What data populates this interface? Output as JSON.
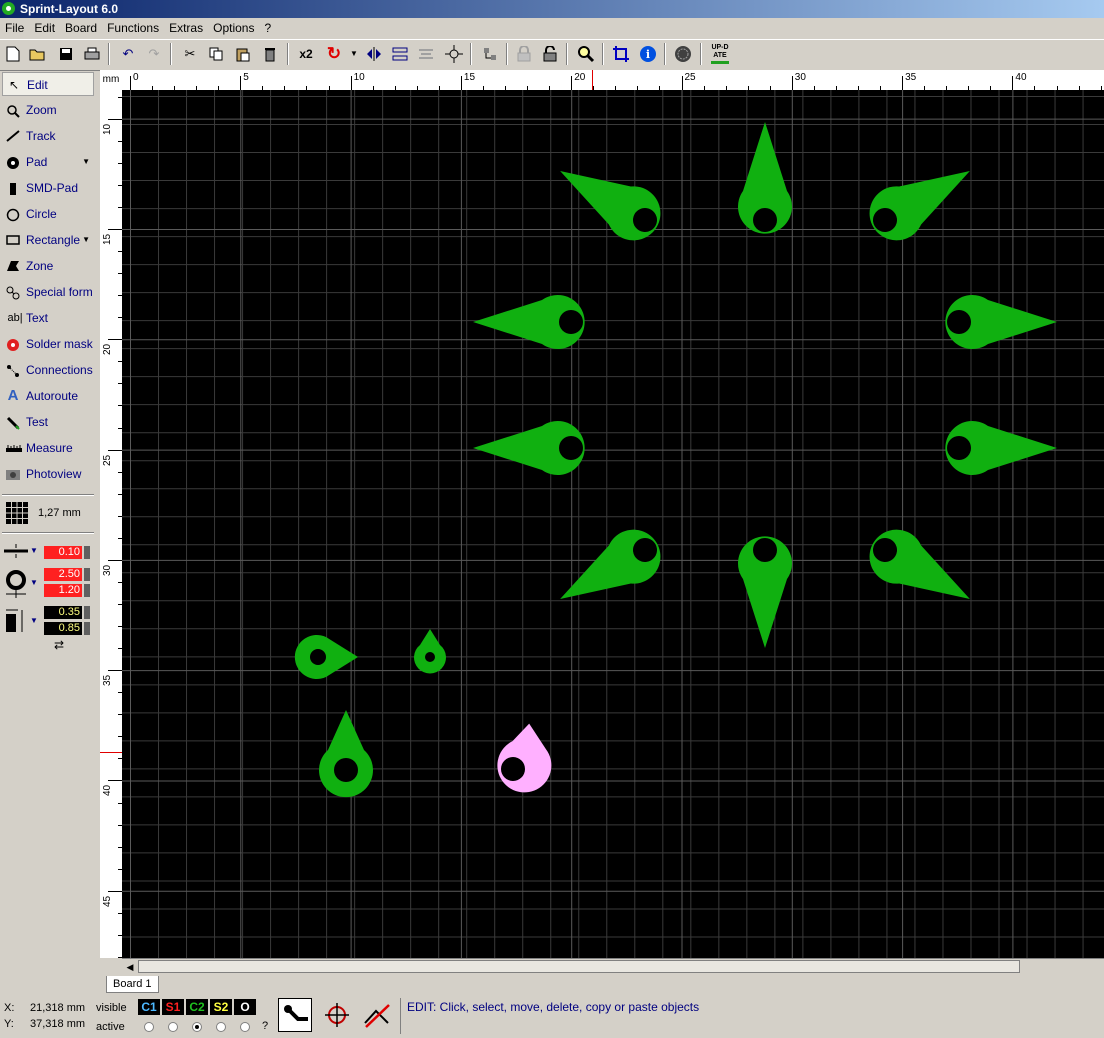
{
  "window": {
    "title": "Sprint-Layout 6.0"
  },
  "menu": [
    "File",
    "Edit",
    "Board",
    "Functions",
    "Extras",
    "Options",
    "?"
  ],
  "toolbar": {
    "icons": [
      "new-file-icon",
      "open-folder-icon",
      "save-icon",
      "print-icon",
      "undo-icon",
      "redo-icon",
      "cut-icon",
      "copy-icon",
      "paste-icon",
      "delete-icon",
      "multiply-icon",
      "rotate-icon",
      "mirror-horizontal-icon",
      "mirror-vertical-icon",
      "align-icon",
      "snap-icon",
      "group-icon",
      "lock-icon",
      "unlock-icon",
      "zoom-icon",
      "crop-icon",
      "info-icon",
      "drill-icon",
      "update-icon"
    ],
    "multiply_label": "x2",
    "update_label": "UP-DATE"
  },
  "tools": [
    {
      "label": "Edit",
      "icon": "cursor-icon",
      "active": true
    },
    {
      "label": "Zoom",
      "icon": "magnifier-icon"
    },
    {
      "label": "Track",
      "icon": "track-icon"
    },
    {
      "label": "Pad",
      "icon": "pad-icon",
      "dropdown": true
    },
    {
      "label": "SMD-Pad",
      "icon": "smd-pad-icon"
    },
    {
      "label": "Circle",
      "icon": "circle-icon"
    },
    {
      "label": "Rectangle",
      "icon": "rectangle-icon",
      "dropdown": true
    },
    {
      "label": "Zone",
      "icon": "zone-icon"
    },
    {
      "label": "Special form",
      "icon": "special-form-icon"
    },
    {
      "label": "Text",
      "icon": "text-icon"
    },
    {
      "label": "Solder mask",
      "icon": "solder-mask-icon"
    },
    {
      "label": "Connections",
      "icon": "connections-icon"
    },
    {
      "label": "Autoroute",
      "icon": "autoroute-icon"
    },
    {
      "label": "Test",
      "icon": "test-icon"
    },
    {
      "label": "Measure",
      "icon": "measure-icon"
    },
    {
      "label": "Photoview",
      "icon": "photoview-icon"
    }
  ],
  "grid": {
    "label": "1,27 mm"
  },
  "params": {
    "track_width": "0.10",
    "pad_outer": "2.50",
    "pad_inner": "1.20",
    "smd_width": "0.35",
    "smd_height": "0.85"
  },
  "ruler": {
    "unit": "mm",
    "h_labels": [
      "0",
      "5",
      "10",
      "15",
      "20",
      "25",
      "30",
      "35",
      "40"
    ],
    "v_labels": [
      "10",
      "15",
      "20",
      "25",
      "30",
      "35",
      "40",
      "45"
    ]
  },
  "board_tab": "Board 1",
  "status": {
    "x_label": "X:",
    "x_value": "21,318 mm",
    "y_label": "Y:",
    "y_value": "37,318 mm",
    "visible_label": "visible",
    "active_label": "active",
    "layers": [
      {
        "name": "C1",
        "color": "#4db8ff"
      },
      {
        "name": "S1",
        "color": "#ff2020"
      },
      {
        "name": "C2",
        "color": "#20c020"
      },
      {
        "name": "S2",
        "color": "#ffff40"
      },
      {
        "name": "O",
        "color": "#ffffff"
      }
    ],
    "active_layer": 2,
    "question": "?",
    "message": "EDIT:  Click, select, move, delete, copy or paste objects"
  },
  "colors": {
    "pad": "#10b010",
    "pad_selected": "#ffb0ff",
    "canvas": "#000000",
    "grid": "#3a3a3a"
  }
}
